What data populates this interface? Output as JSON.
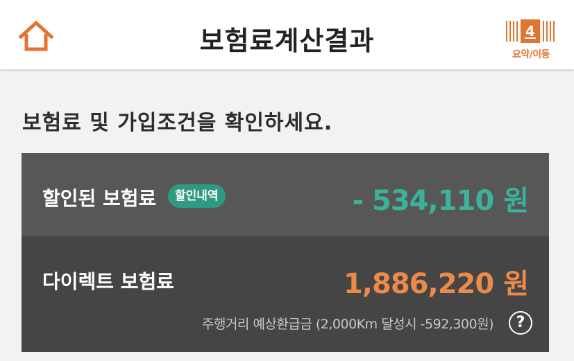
{
  "header": {
    "title": "보험료계산결과",
    "home_icon": "home-icon",
    "step_number": "4",
    "step_label": "요약/이동",
    "accent_color": "#e2742f"
  },
  "instruction": "보험료 및 가입조건을 확인하세요.",
  "discount": {
    "label": "할인된 보험료",
    "details_pill": "할인내역",
    "amount": "- 534,110",
    "unit": "원",
    "color": "#3bb39a"
  },
  "direct": {
    "label": "다이렉트 보험료",
    "amount": "1,886,220",
    "unit": "원",
    "color": "#ec8a4a",
    "footnote": "주행거리 예상환급금 (2,000Km 달성시 -592,300원)",
    "help_icon": "help-icon",
    "help_glyph": "?"
  }
}
